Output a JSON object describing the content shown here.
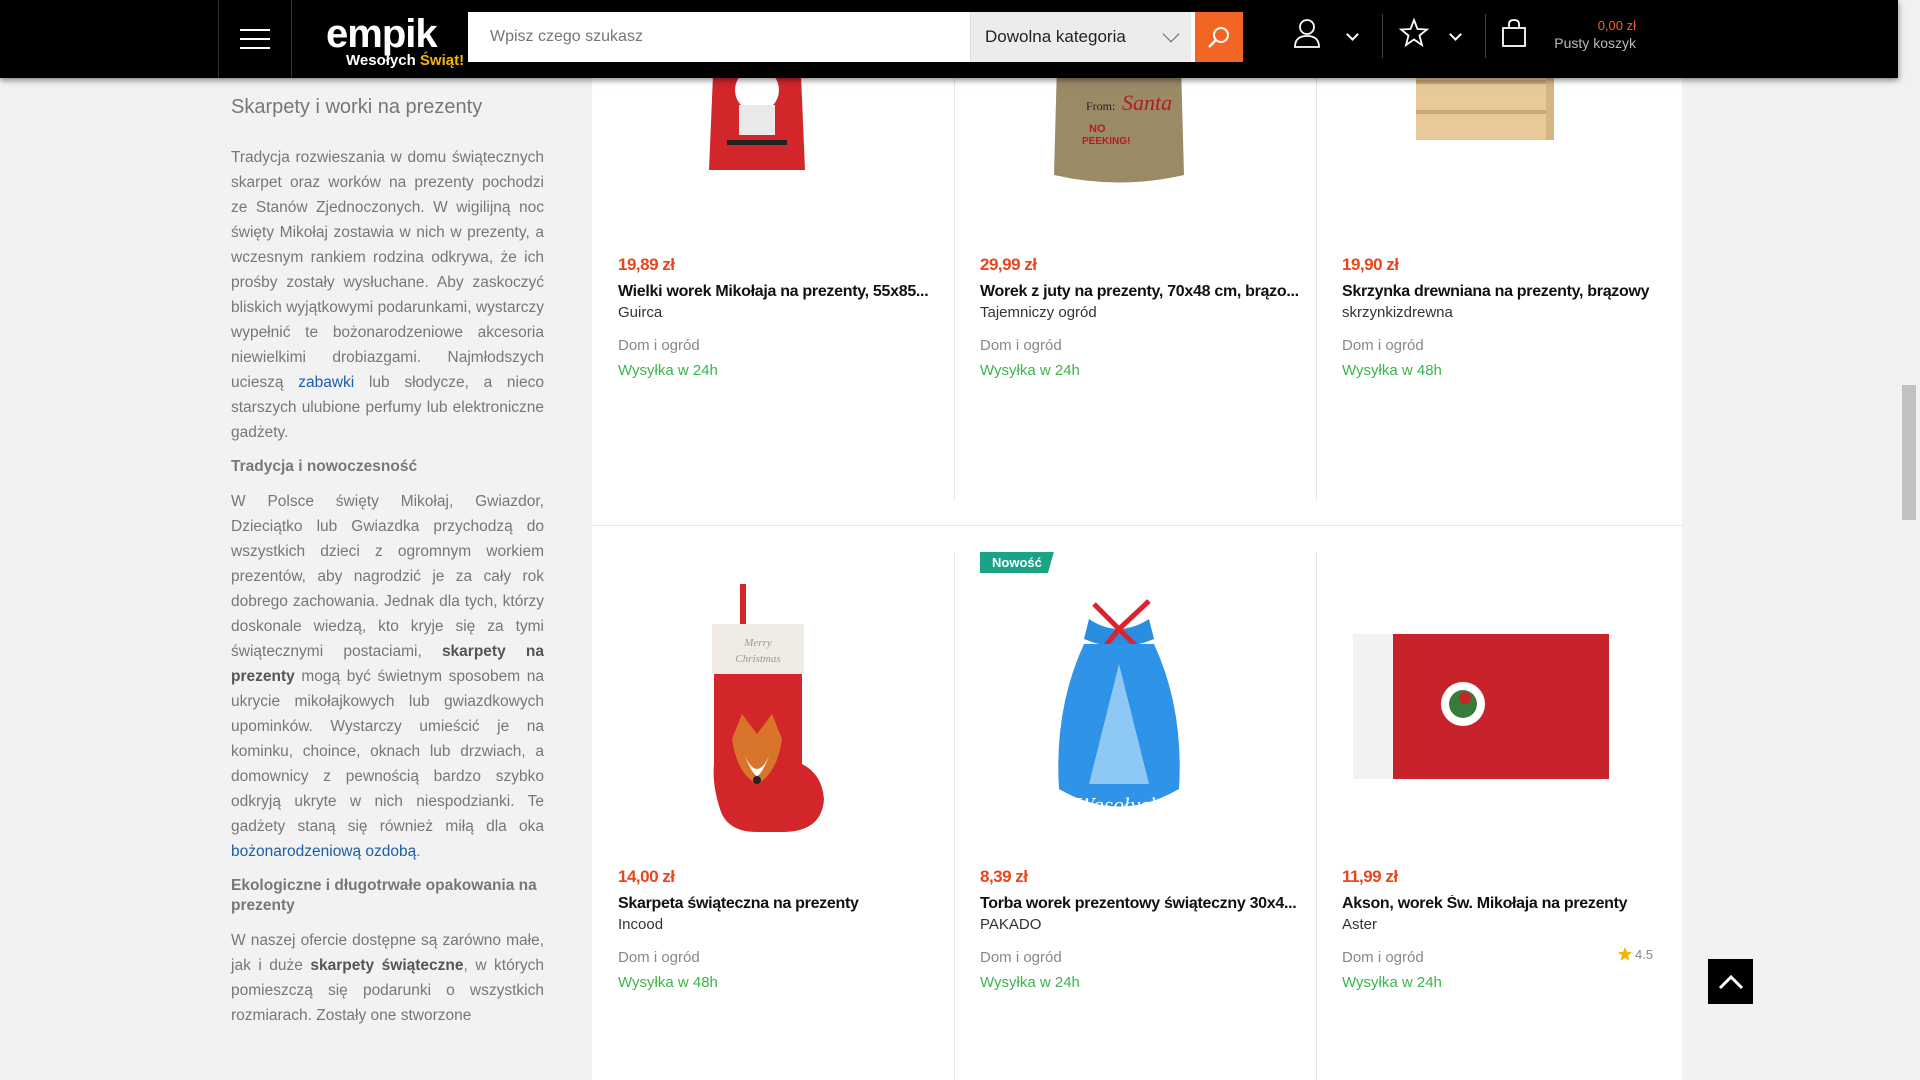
{
  "header": {
    "logo_name": "empik",
    "logo_tag_a": "Wesołych ",
    "logo_tag_b": "Świąt!",
    "search_placeholder": "Wpisz czego szukasz",
    "category_select": "Dowolna kategoria",
    "cart_price": "0,00 zł",
    "cart_label": "Pusty koszyk",
    "icons": [
      "menu-icon",
      "search-icon",
      "user-icon",
      "star-icon",
      "bag-icon"
    ],
    "accent_color": "#f26522"
  },
  "sidebar": {
    "title": "Skarpety i worki na prezenty",
    "p1_a": "Tradycja rozwieszania w domu świątecznych skarpet oraz worków na prezenty pochodzi ze Stanów Zjednoczonych. W wigilijną noc święty Mikołaj zostawia w nich w prezenty, a wczesnym rankiem rodzina odkrywa, że ich prośby zostały wysłuchane. Aby zaskoczyć bliskich wyjątkowymi podarunkami, wystarczy wypełnić te bożonarodzeniowe akcesoria niewielkimi drobiazgami. Najmłodszych ucieszą ",
    "p1_link": "zabawki",
    "p1_b": " lub słodycze, a nieco starszych ulubione perfumy lub elektroniczne gadżety.",
    "h1": "Tradycja i nowoczesność",
    "p2_a": "W Polsce święty Mikołaj, Gwiazdor, Dzieciątko lub Gwiazdka przychodzą do wszystkich dzieci z ogromnym workiem prezentów, aby nagrodzić je za cały rok dobrego zachowania. Jednak dla tych, którzy doskonale wiedzą, kto kryje się za tymi świątecznymi postaciami, ",
    "p2_bold": "skarpety na prezenty",
    "p2_b": " mogą być świetnym sposobem na ukrycie mikołajkowych lub gwiazdkowych upominków. Wystarczy umieścić je na kominku, choince, oknach lub drzwiach, a domownicy z pewnością bardzo szybko odkryją ukryte w nich niespodzianki. Te gadżety staną się również miłą dla oka ",
    "p2_link": "bożonarodzeniową ozdobą",
    "p2_c": ".",
    "h2": "Ekologiczne i długotrwałe opakowania na prezenty",
    "p3_a": "W naszej ofercie dostępne są zarówno małe, jak i duże ",
    "p3_bold": "skarpety świąteczne",
    "p3_b": ", w których pomieszczą się podarunki o wszystkich rozmiarach. Zostały one stworzone"
  },
  "products": [
    {
      "price": "19,89 zł",
      "title": "Wielki worek Mikołaja na prezenty, 55x85...",
      "brand": "Guirca",
      "category": "Dom i ogród",
      "shipping": "Wysyłka w 24h"
    },
    {
      "price": "29,99 zł",
      "title": "Worek z juty na prezenty, 70x48 cm, brązo...",
      "brand": "Tajemniczy ogród",
      "category": "Dom i ogród",
      "shipping": "Wysyłka w 24h"
    },
    {
      "price": "19,90 zł",
      "title": "Skrzynka drewniana na prezenty, brązowy",
      "brand": "skrzynkizdrewna",
      "category": "Dom i ogród",
      "shipping": "Wysyłka w 48h"
    },
    {
      "price": "14,00 zł",
      "title": "Skarpeta świąteczna na prezenty",
      "brand": "Incood",
      "category": "Dom i ogród",
      "shipping": "Wysyłka w 48h"
    },
    {
      "price": "8,39 zł",
      "title": "Torba worek prezentowy świąteczny 30x4...",
      "brand": "PAKADO",
      "category": "Dom i ogród",
      "shipping": "Wysyłka w 24h",
      "badge": "Nowość"
    },
    {
      "price": "11,99 zł",
      "title": "Akson, worek Św. Mikołaja na prezenty",
      "brand": "Aster",
      "category": "Dom i ogród",
      "shipping": "Wysyłka w 24h",
      "rating": "4.5"
    }
  ],
  "misc": {
    "sock_text_1": "Merry",
    "sock_text_2": "Christmas",
    "sack_text_1": "From:",
    "sack_text_2": "Santa",
    "sack_text_3": "NO",
    "sack_text_4": "PEEKING!",
    "bag_text": "Wesołych"
  }
}
